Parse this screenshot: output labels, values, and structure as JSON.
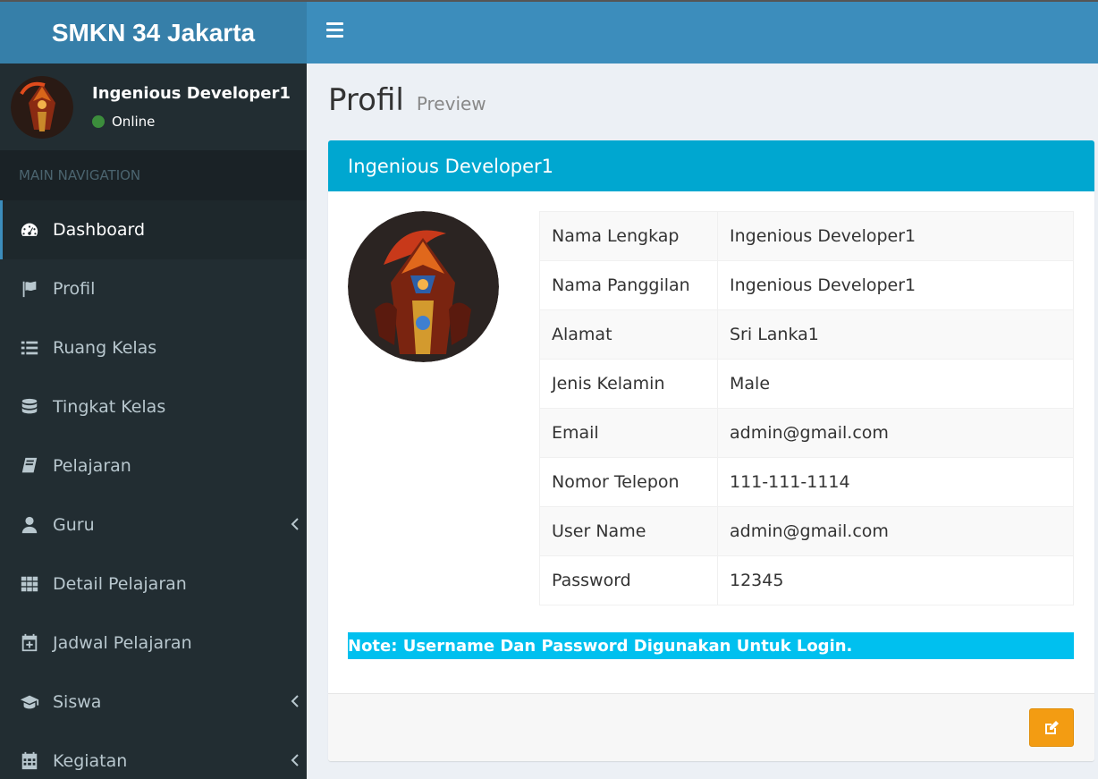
{
  "app": {
    "title": "SMKN 34 Jakarta"
  },
  "user": {
    "name": "Ingenious Developer1",
    "status": "Online"
  },
  "nav": {
    "header": "MAIN NAVIGATION",
    "items": [
      {
        "label": "Dashboard",
        "icon": "dashboard-icon",
        "active": true
      },
      {
        "label": "Profil",
        "icon": "flag-icon"
      },
      {
        "label": "Ruang Kelas",
        "icon": "list-icon"
      },
      {
        "label": "Tingkat Kelas",
        "icon": "database-icon"
      },
      {
        "label": "Pelajaran",
        "icon": "book-icon"
      },
      {
        "label": "Guru",
        "icon": "user-icon",
        "has_children": true
      },
      {
        "label": "Detail Pelajaran",
        "icon": "grid-icon"
      },
      {
        "label": "Jadwal Pelajaran",
        "icon": "calendar-plus-icon"
      },
      {
        "label": "Siswa",
        "icon": "graduation-cap-icon",
        "has_children": true
      },
      {
        "label": "Kegiatan",
        "icon": "calendar-icon",
        "has_children": true
      }
    ]
  },
  "page": {
    "title": "Profil",
    "subtitle": "Preview"
  },
  "profile": {
    "header": "Ingenious Developer1",
    "rows": [
      {
        "label": "Nama Lengkap",
        "value": "Ingenious Developer1"
      },
      {
        "label": "Nama Panggilan",
        "value": "Ingenious Developer1"
      },
      {
        "label": "Alamat",
        "value": "Sri Lanka1"
      },
      {
        "label": "Jenis Kelamin",
        "value": "Male"
      },
      {
        "label": "Email",
        "value": "admin@gmail.com"
      },
      {
        "label": "Nomor Telepon",
        "value": "111-111-1114"
      },
      {
        "label": "User Name",
        "value": "admin@gmail.com"
      },
      {
        "label": "Password",
        "value": "12345"
      }
    ],
    "note": "Note: Username Dan Password Digunakan Untuk Login."
  },
  "colors": {
    "topbar": "#3c8dbc",
    "logo": "#367fa9",
    "sidebar": "#222d32",
    "box_header": "#00a7d0",
    "note": "#00c0ef",
    "edit_button": "#f39c12",
    "online": "#3c8d3c"
  }
}
